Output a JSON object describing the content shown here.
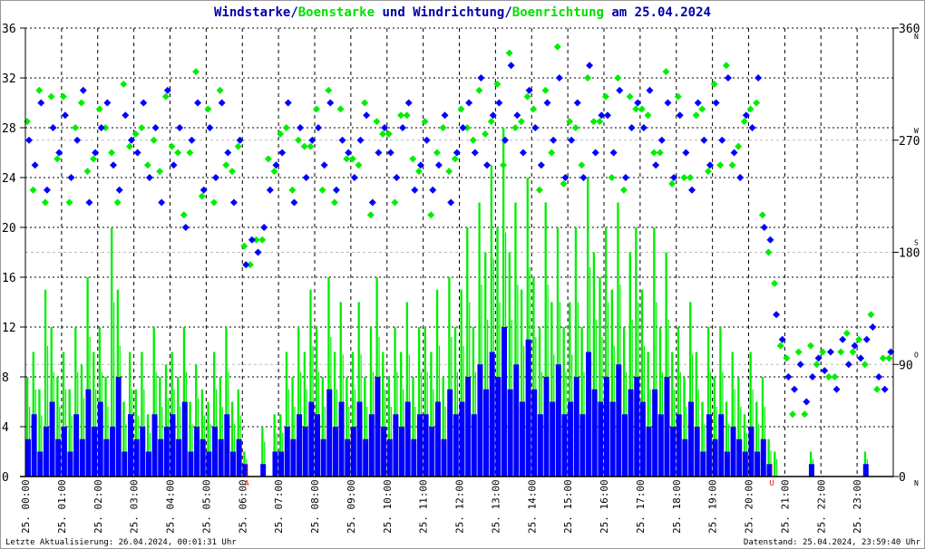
{
  "chart_data": {
    "type": "bar+scatter",
    "title_parts": [
      {
        "text": "Windstarke",
        "color": "#0000a8"
      },
      {
        "text": "/",
        "color": "#0000a8"
      },
      {
        "text": "Boenstarke",
        "color": "#00e000"
      },
      {
        "text": " und ",
        "color": "#0000a8"
      },
      {
        "text": "Windrichtung",
        "color": "#0000a8"
      },
      {
        "text": "/",
        "color": "#0000a8"
      },
      {
        "text": "Boenrichtung",
        "color": "#00e000"
      },
      {
        "text": " am 25.04.2024",
        "color": "#0000a8"
      }
    ],
    "left_axis": {
      "ylim": [
        0,
        36
      ],
      "ticks": [
        "0",
        "4",
        "8",
        "12",
        "16",
        "20",
        "24",
        "28",
        "32",
        "36"
      ]
    },
    "right_axis": {
      "ylim": [
        0,
        360
      ],
      "ticks": [
        {
          "value": 0,
          "label": "0",
          "compass": "N"
        },
        {
          "value": 90,
          "label": "90",
          "compass": "O"
        },
        {
          "value": 180,
          "label": "180",
          "compass": "S"
        },
        {
          "value": 270,
          "label": "270",
          "compass": "W"
        },
        {
          "value": 360,
          "label": "360",
          "compass": "N"
        }
      ]
    },
    "x_labels": [
      "25. 00:00",
      "25. 01:00",
      "25. 02:00",
      "25. 03:00",
      "25. 04:00",
      "25. 05:00",
      "25. 06:00",
      "25. 07:00",
      "25. 08:00",
      "25. 09:00",
      "25. 10:00",
      "25. 11:00",
      "25. 12:00",
      "25. 13:00",
      "25. 14:00",
      "25. 15:00",
      "25. 16:00",
      "25. 17:00",
      "25. 18:00",
      "25. 19:00",
      "25. 20:00",
      "25. 21:00",
      "25. 22:00",
      "25. 23:00"
    ],
    "x_range_hours": [
      0,
      24
    ],
    "sample_interval_minutes": 10,
    "annotations": [
      {
        "label": "A",
        "hour": 6.12,
        "meaning": "sunrise",
        "color": "#e00000"
      },
      {
        "label": "U",
        "hour": 20.64,
        "meaning": "sunset",
        "color": "#e00000"
      }
    ],
    "colors": {
      "wind": "#0000ff",
      "gust": "#00ee00",
      "grid": "#000000",
      "grid_dir": "#bbbbbb"
    },
    "series": [
      {
        "name": "Windstarke",
        "kind": "bar",
        "axis": "left",
        "values": [
          3,
          5,
          2,
          4,
          6,
          3,
          4,
          2,
          5,
          3,
          7,
          4,
          6,
          3,
          4,
          8,
          2,
          5,
          3,
          4,
          2,
          5,
          3,
          4,
          5,
          3,
          6,
          2,
          4,
          3,
          2,
          4,
          3,
          5,
          2,
          3,
          1,
          0,
          0,
          1,
          0,
          2,
          2,
          4,
          3,
          5,
          4,
          6,
          5,
          3,
          7,
          4,
          6,
          3,
          4,
          6,
          3,
          5,
          8,
          4,
          3,
          5,
          4,
          6,
          3,
          5,
          5,
          4,
          6,
          3,
          7,
          5,
          6,
          8,
          5,
          9,
          7,
          10,
          8,
          12,
          7,
          9,
          6,
          11,
          7,
          5,
          8,
          6,
          9,
          5,
          6,
          8,
          5,
          10,
          7,
          6,
          8,
          6,
          9,
          5,
          7,
          8,
          6,
          4,
          7,
          5,
          8,
          4,
          5,
          3,
          6,
          4,
          2,
          5,
          3,
          5,
          2,
          4,
          3,
          2,
          4,
          2,
          3,
          1,
          0,
          0,
          0,
          0,
          0,
          0,
          1,
          0,
          0,
          0,
          0,
          0,
          0,
          0,
          0,
          1,
          0,
          0,
          0,
          0
        ]
      },
      {
        "name": "Boenstarke",
        "kind": "bar",
        "axis": "left",
        "values": [
          8,
          10,
          7,
          15,
          12,
          8,
          10,
          7,
          12,
          9,
          16,
          10,
          12,
          8,
          20,
          15,
          6,
          10,
          7,
          10,
          5,
          12,
          8,
          9,
          10,
          8,
          12,
          6,
          9,
          7,
          6,
          10,
          8,
          12,
          6,
          7,
          2,
          0,
          0,
          4,
          0,
          5,
          5,
          10,
          8,
          12,
          10,
          15,
          12,
          8,
          16,
          10,
          14,
          8,
          10,
          14,
          8,
          12,
          16,
          10,
          8,
          12,
          10,
          14,
          8,
          12,
          12,
          10,
          15,
          8,
          16,
          12,
          15,
          20,
          12,
          22,
          18,
          25,
          20,
          28,
          18,
          22,
          15,
          24,
          16,
          12,
          22,
          14,
          20,
          12,
          14,
          20,
          12,
          24,
          18,
          16,
          20,
          15,
          22,
          12,
          18,
          20,
          15,
          10,
          20,
          12,
          18,
          10,
          12,
          8,
          14,
          10,
          6,
          12,
          8,
          12,
          6,
          10,
          8,
          5,
          10,
          6,
          8,
          3,
          2,
          0,
          0,
          0,
          0,
          0,
          2,
          0,
          0,
          0,
          0,
          0,
          0,
          0,
          0,
          2,
          0,
          0,
          0,
          0
        ]
      },
      {
        "name": "Windrichtung",
        "kind": "scatter",
        "axis": "right",
        "values": [
          270,
          250,
          300,
          230,
          280,
          260,
          290,
          240,
          270,
          310,
          220,
          260,
          280,
          300,
          250,
          230,
          290,
          270,
          260,
          300,
          240,
          280,
          220,
          310,
          250,
          280,
          200,
          270,
          300,
          230,
          280,
          240,
          300,
          260,
          220,
          270,
          170,
          190,
          180,
          200,
          230,
          250,
          260,
          300,
          220,
          280,
          240,
          270,
          280,
          250,
          300,
          230,
          270,
          260,
          240,
          270,
          290,
          220,
          260,
          280,
          260,
          240,
          280,
          300,
          230,
          250,
          270,
          230,
          250,
          290,
          220,
          260,
          280,
          300,
          260,
          320,
          250,
          290,
          300,
          270,
          330,
          290,
          260,
          310,
          280,
          250,
          300,
          270,
          320,
          240,
          270,
          300,
          240,
          330,
          260,
          290,
          290,
          260,
          310,
          240,
          280,
          300,
          280,
          310,
          250,
          270,
          300,
          240,
          290,
          260,
          230,
          300,
          270,
          250,
          300,
          270,
          320,
          260,
          240,
          290,
          280,
          320,
          200,
          190,
          130,
          110,
          80,
          70,
          90,
          60,
          80,
          95,
          85,
          100,
          70,
          110,
          90,
          105,
          95,
          110,
          120,
          80,
          70,
          100
        ]
      },
      {
        "name": "Boenrichtung",
        "kind": "scatter",
        "axis": "right",
        "values": [
          285,
          230,
          310,
          220,
          305,
          255,
          305,
          220,
          280,
          300,
          245,
          255,
          295,
          280,
          260,
          220,
          315,
          265,
          275,
          280,
          250,
          270,
          245,
          305,
          265,
          260,
          210,
          260,
          325,
          225,
          295,
          220,
          310,
          250,
          245,
          265,
          185,
          170,
          190,
          190,
          255,
          245,
          275,
          280,
          230,
          270,
          265,
          265,
          295,
          230,
          310,
          220,
          295,
          255,
          255,
          250,
          300,
          210,
          285,
          275,
          275,
          220,
          290,
          290,
          255,
          245,
          285,
          210,
          260,
          280,
          245,
          255,
          295,
          280,
          270,
          310,
          275,
          285,
          315,
          250,
          340,
          280,
          285,
          305,
          295,
          230,
          310,
          260,
          345,
          235,
          285,
          280,
          250,
          320,
          285,
          285,
          305,
          240,
          320,
          230,
          305,
          295,
          295,
          290,
          260,
          260,
          325,
          235,
          305,
          240,
          240,
          290,
          295,
          245,
          315,
          250,
          330,
          250,
          265,
          285,
          295,
          300,
          210,
          180,
          155,
          105,
          95,
          50,
          100,
          50,
          105,
          90,
          100,
          80,
          80,
          100,
          115,
          100,
          110,
          90,
          130,
          70,
          95,
          95
        ]
      }
    ]
  },
  "footer": {
    "last_update": "Letzte Aktualisierung: 26.04.2024, 00:01:31 Uhr",
    "data_state": "Datenstand: 25.04.2024, 23:59:40 Uhr"
  }
}
